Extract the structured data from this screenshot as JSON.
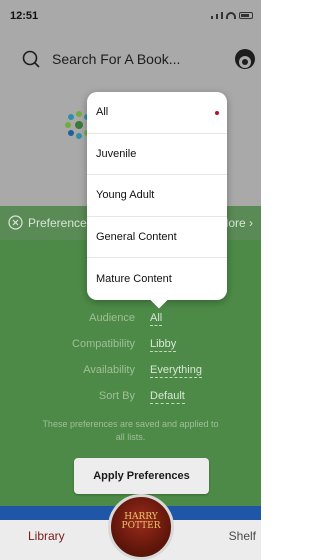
{
  "status_bar": {
    "time": "12:51"
  },
  "search": {
    "placeholder": "Search For A Book..."
  },
  "preferences": {
    "header_label": "Preferences",
    "explore_label": "Explore",
    "rows": [
      {
        "label": "Audience",
        "value": "All"
      },
      {
        "label": "Compatibility",
        "value": "Libby"
      },
      {
        "label": "Availability",
        "value": "Everything"
      },
      {
        "label": "Sort By",
        "value": "Default"
      }
    ],
    "note": "These preferences are saved and applied to all lists.",
    "apply_button": "Apply Preferences"
  },
  "dropdown": {
    "options": [
      "All",
      "Juvenile",
      "Young Adult",
      "General Content",
      "Mature Content"
    ],
    "selected": "All"
  },
  "bottom_nav": {
    "left_tab": "Library",
    "right_tab": "Shelf"
  },
  "book": {
    "title": "HARRY POTTER"
  },
  "colors": {
    "overlay_gray": "#a9a9a9",
    "panel_green": "#4d8a47",
    "accent_blue": "#1f56a8",
    "selection_dot": "#b5122b"
  },
  "icons": [
    "search-icon",
    "account-icon",
    "logo-icon",
    "close-circle-icon",
    "chevron-right-icon"
  ]
}
